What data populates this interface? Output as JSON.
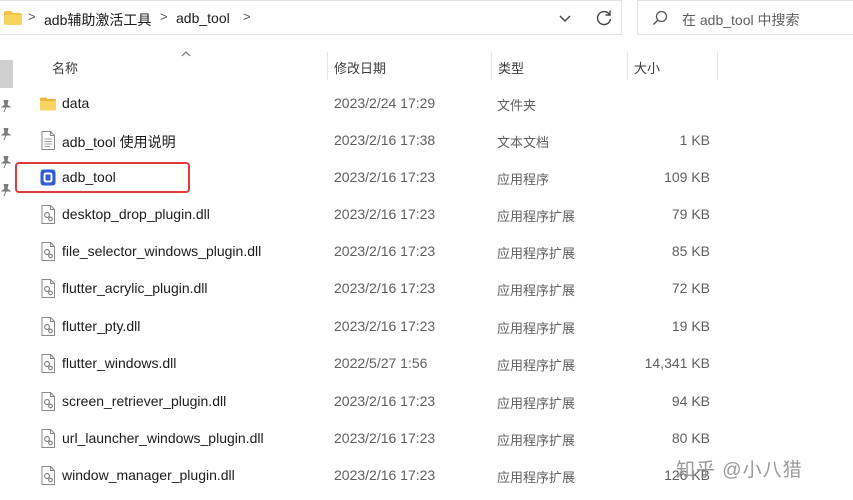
{
  "address_bar": {
    "breadcrumbs": [
      "adb辅助激活工具",
      "adb_tool"
    ],
    "separator": ">",
    "icons": [
      "folder-icon",
      "chevron-down-icon",
      "refresh-icon"
    ]
  },
  "search": {
    "placeholder": "在 adb_tool 中搜索",
    "icon": "search-icon"
  },
  "columns": {
    "name": "名称",
    "date": "修改日期",
    "type": "类型",
    "size": "大小"
  },
  "files": [
    {
      "name": "data",
      "date": "2023/2/24 17:29",
      "type": "文件夹",
      "size": "",
      "icon": "folder-icon"
    },
    {
      "name": "adb_tool 使用说明",
      "date": "2023/2/16 17:38",
      "type": "文本文档",
      "size": "1 KB",
      "icon": "text-file-icon"
    },
    {
      "name": "adb_tool",
      "date": "2023/2/16 17:23",
      "type": "应用程序",
      "size": "109 KB",
      "icon": "app-icon"
    },
    {
      "name": "desktop_drop_plugin.dll",
      "date": "2023/2/16 17:23",
      "type": "应用程序扩展",
      "size": "79 KB",
      "icon": "dll-icon"
    },
    {
      "name": "file_selector_windows_plugin.dll",
      "date": "2023/2/16 17:23",
      "type": "应用程序扩展",
      "size": "85 KB",
      "icon": "dll-icon"
    },
    {
      "name": "flutter_acrylic_plugin.dll",
      "date": "2023/2/16 17:23",
      "type": "应用程序扩展",
      "size": "72 KB",
      "icon": "dll-icon"
    },
    {
      "name": "flutter_pty.dll",
      "date": "2023/2/16 17:23",
      "type": "应用程序扩展",
      "size": "19 KB",
      "icon": "dll-icon"
    },
    {
      "name": "flutter_windows.dll",
      "date": "2022/5/27 1:56",
      "type": "应用程序扩展",
      "size": "14,341 KB",
      "icon": "dll-icon"
    },
    {
      "name": "screen_retriever_plugin.dll",
      "date": "2023/2/16 17:23",
      "type": "应用程序扩展",
      "size": "94 KB",
      "icon": "dll-icon"
    },
    {
      "name": "url_launcher_windows_plugin.dll",
      "date": "2023/2/16 17:23",
      "type": "应用程序扩展",
      "size": "80 KB",
      "icon": "dll-icon"
    },
    {
      "name": "window_manager_plugin.dll",
      "date": "2023/2/16 17:23",
      "type": "应用程序扩展",
      "size": "126 KB",
      "icon": "dll-icon"
    }
  ],
  "watermark": "知乎 @小八猎",
  "colors": {
    "highlight": "#e23b3b",
    "folder": "#f4c542",
    "app": "#2f5bd3"
  }
}
